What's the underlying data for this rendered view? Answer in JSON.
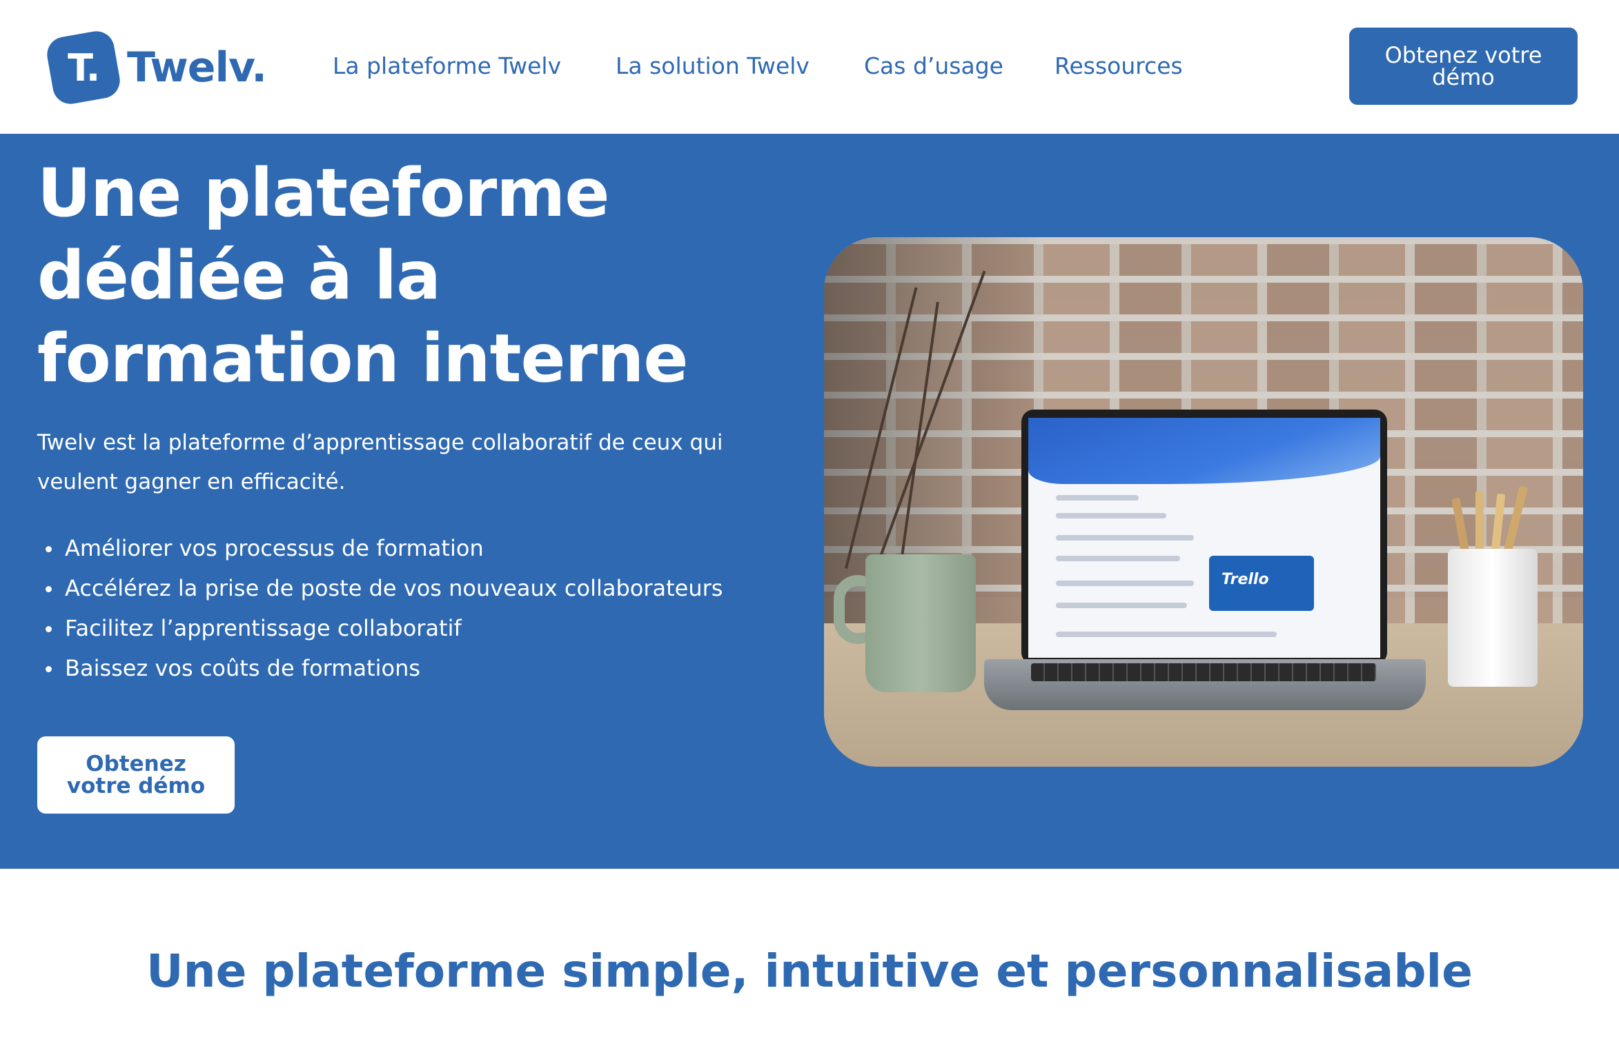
{
  "brand": {
    "logo_mark": "T.",
    "logo_word": "Twelv."
  },
  "nav": {
    "items": [
      "La plateforme Twelv",
      "La solution Twelv",
      "Cas d’usage",
      "Ressources"
    ],
    "cta_label": "Obtenez votre démo"
  },
  "hero": {
    "title": "Une plateforme dédiée à la formation interne",
    "description": "Twelv est la plateforme d’apprentissage collaboratif de ceux qui veulent gagner en efficacité.",
    "bullets": [
      "Améliorer vos processus de formation",
      "Accélérez la prise de poste de vos nouveaux collaborateurs",
      "Facilitez l’apprentissage collaboratif",
      "Baissez vos coûts de formations"
    ],
    "cta_label": "Obtenez votre démo",
    "image_screen_card": "Trello"
  },
  "section": {
    "title": "Une plateforme simple, intuitive et personnalisable"
  },
  "colors": {
    "brand_blue": "#2e69b2",
    "white": "#ffffff"
  },
  "icons": [
    "logo-mark-icon",
    "bullet-dot-icon"
  ]
}
